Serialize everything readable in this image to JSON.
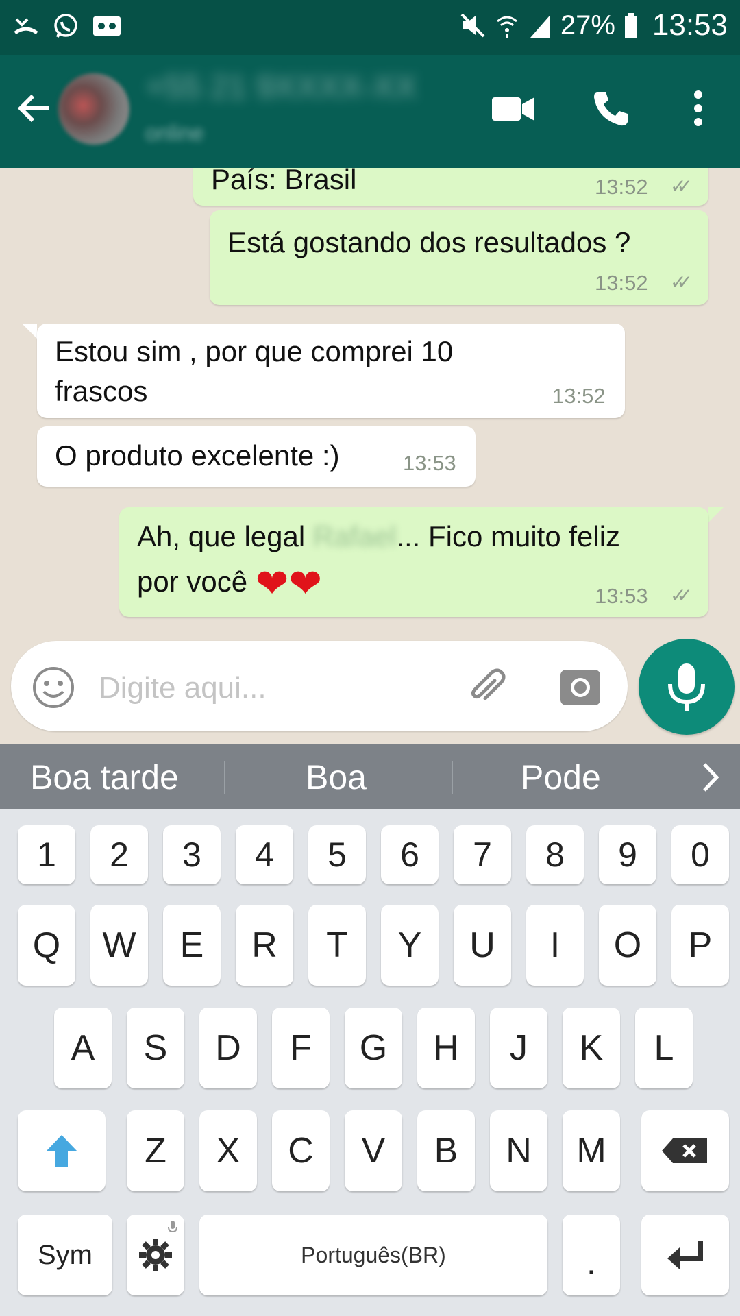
{
  "status_bar": {
    "battery": "27%",
    "time": "13:53",
    "icons": [
      "missed-call-icon",
      "whatsapp-icon",
      "voicemail-icon",
      "mute-icon",
      "wifi-icon",
      "signal-icon",
      "battery-icon"
    ]
  },
  "app_bar": {
    "contact_name": "+55 21 9XXXX-XX",
    "contact_status": "online",
    "icons": [
      "back-arrow-icon",
      "video-call-icon",
      "phone-icon",
      "more-vert-icon"
    ],
    "color": "#075e54"
  },
  "messages": [
    {
      "dir": "out",
      "text": "País: Brasil",
      "time": "13:52",
      "ticks": "✓✓"
    },
    {
      "dir": "out",
      "text": "Está gostando dos resultados ?",
      "time": "13:52",
      "ticks": "✓✓"
    },
    {
      "dir": "in",
      "line1": "Estou sim , por que comprei 10",
      "line2": "frascos",
      "time": "13:52"
    },
    {
      "dir": "in",
      "text": "O produto excelente :)",
      "time": "13:53"
    },
    {
      "dir": "out",
      "line1_a": "Ah, que legal ",
      "line1_blur": "Rafael",
      "line1_b": "... Fico muito feliz",
      "line2": "por você",
      "emoji": "❤❤",
      "time": "13:53",
      "ticks": "✓✓"
    }
  ],
  "input": {
    "placeholder": "Digite aqui...",
    "icons": [
      "emoji-icon",
      "attach-icon",
      "camera-icon",
      "mic-icon"
    ]
  },
  "suggestions": [
    "Boa tarde",
    "Boa",
    "Pode"
  ],
  "keyboard": {
    "numbers": [
      "1",
      "2",
      "3",
      "4",
      "5",
      "6",
      "7",
      "8",
      "9",
      "0"
    ],
    "row1": [
      "Q",
      "W",
      "E",
      "R",
      "T",
      "Y",
      "U",
      "I",
      "O",
      "P"
    ],
    "row2": [
      "A",
      "S",
      "D",
      "F",
      "G",
      "H",
      "J",
      "K",
      "L"
    ],
    "row3": [
      "Z",
      "X",
      "C",
      "V",
      "B",
      "N",
      "M"
    ],
    "sym": "Sym",
    "space": "Português(BR)",
    "period": "."
  }
}
